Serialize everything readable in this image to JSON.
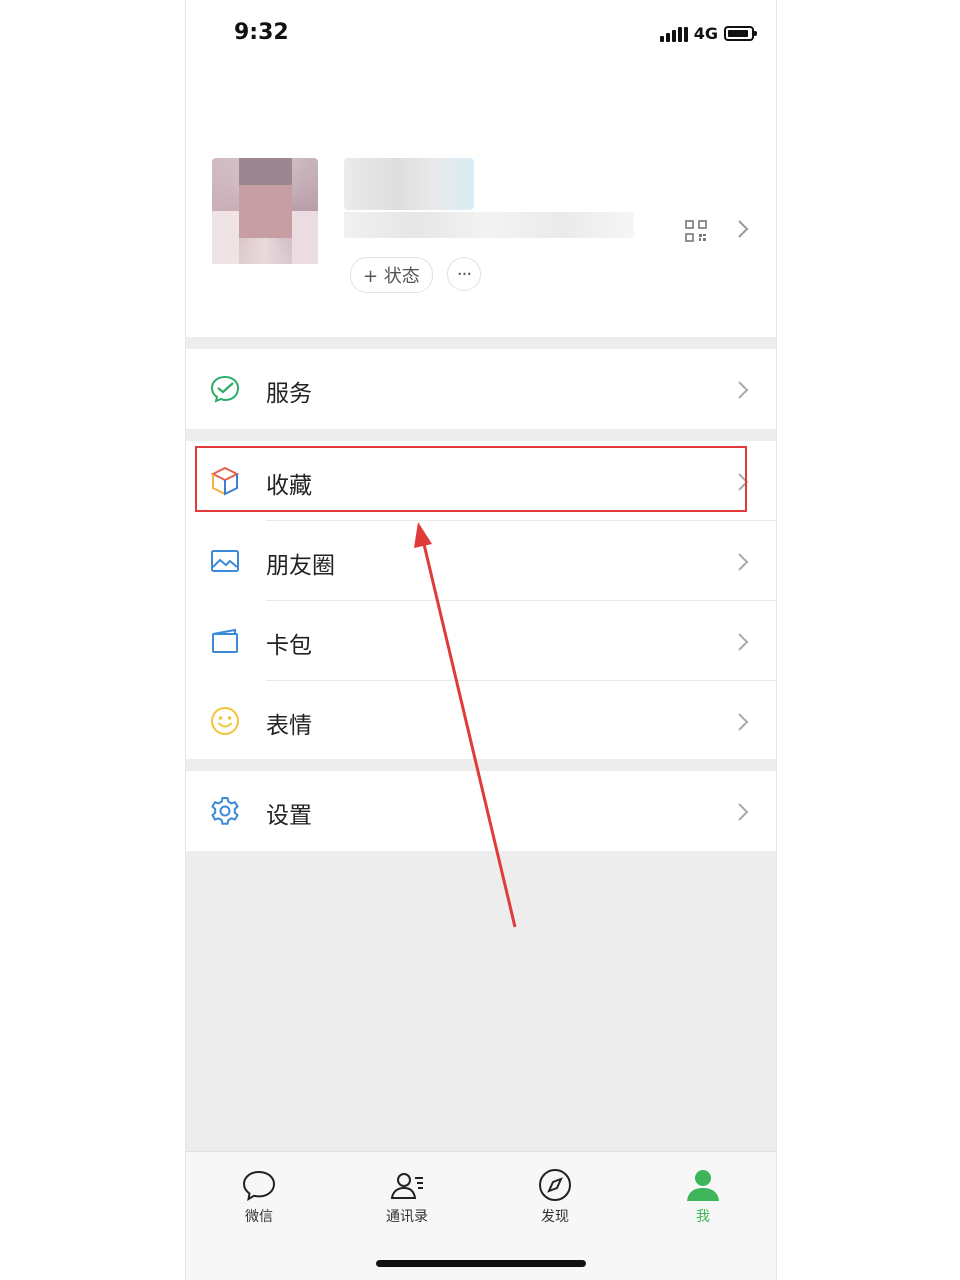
{
  "status_bar": {
    "time": "9:32",
    "network": "4G"
  },
  "profile": {
    "status_button": "+ 状态",
    "more_button": "···"
  },
  "menu": [
    {
      "label": "服务",
      "icon": "wechat-pay-icon"
    },
    {
      "label": "收藏",
      "icon": "favorites-cube-icon"
    },
    {
      "label": "朋友圈",
      "icon": "moments-picture-icon"
    },
    {
      "label": "卡包",
      "icon": "card-wallet-icon"
    },
    {
      "label": "表情",
      "icon": "smiley-icon"
    },
    {
      "label": "设置",
      "icon": "gear-icon"
    }
  ],
  "tabbar": [
    {
      "label": "微信",
      "icon": "chat-bubble-icon",
      "active": false
    },
    {
      "label": "通讯录",
      "icon": "contacts-icon",
      "active": false
    },
    {
      "label": "发现",
      "icon": "compass-icon",
      "active": false
    },
    {
      "label": "我",
      "icon": "person-icon",
      "active": true
    }
  ],
  "colors": {
    "accent_green": "#3cb55b",
    "annotation_red": "#e13a3a",
    "group_gap": "#ededed"
  }
}
